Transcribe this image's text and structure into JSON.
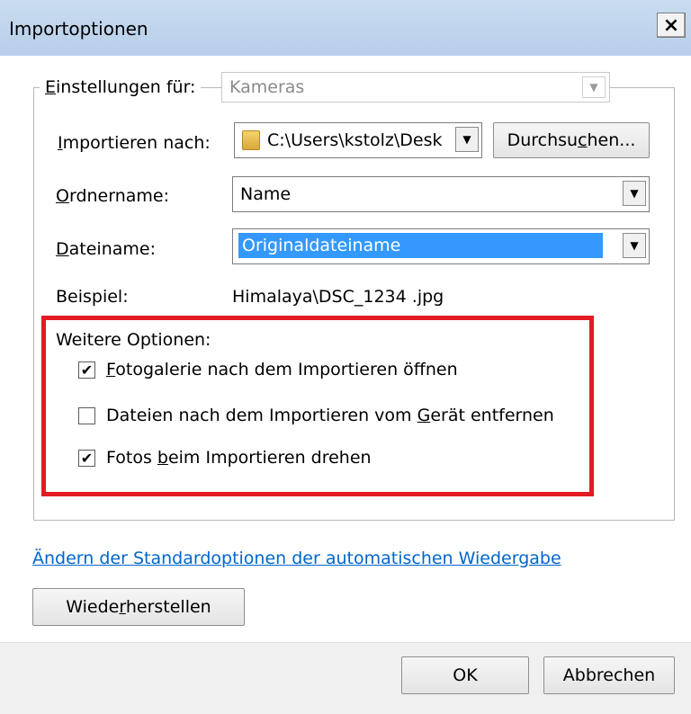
{
  "window": {
    "title": "Importoptionen",
    "close_label": "×"
  },
  "group": {
    "label": "Einstellungen für:",
    "selected_value": "Kameras"
  },
  "fields": {
    "import_to_label": "Importieren nach:",
    "import_to_value": "C:\\Users\\kstolz\\Desk",
    "browse_button": "Durchsuchen...",
    "folder_name_label": "Ordnername:",
    "folder_name_value": "Name",
    "filename_label": "Dateiname:",
    "filename_value": "Originaldateiname",
    "example_label": "Beispiel:",
    "example_value": "Himalaya\\DSC_1234 .jpg"
  },
  "options": {
    "heading": "Weitere Optionen:",
    "items": [
      {
        "label": "Fotogalerie nach dem Importieren öffnen",
        "checked": true
      },
      {
        "label": "Dateien nach dem Importieren vom Gerät entfernen",
        "checked": false
      },
      {
        "label": "Fotos beim Importieren drehen",
        "checked": true
      }
    ],
    "highlight_color": "#e31b23"
  },
  "link": {
    "autoplay_text": "Ändern der Standardoptionen der automatischen Wiedergabe"
  },
  "buttons": {
    "restore": "Wiederherstellen",
    "ok": "OK",
    "cancel": "Abbrechen"
  },
  "icons": {
    "folder": "folder-icon",
    "dropdown": "chevron-down-icon",
    "check": "checkmark-icon"
  }
}
